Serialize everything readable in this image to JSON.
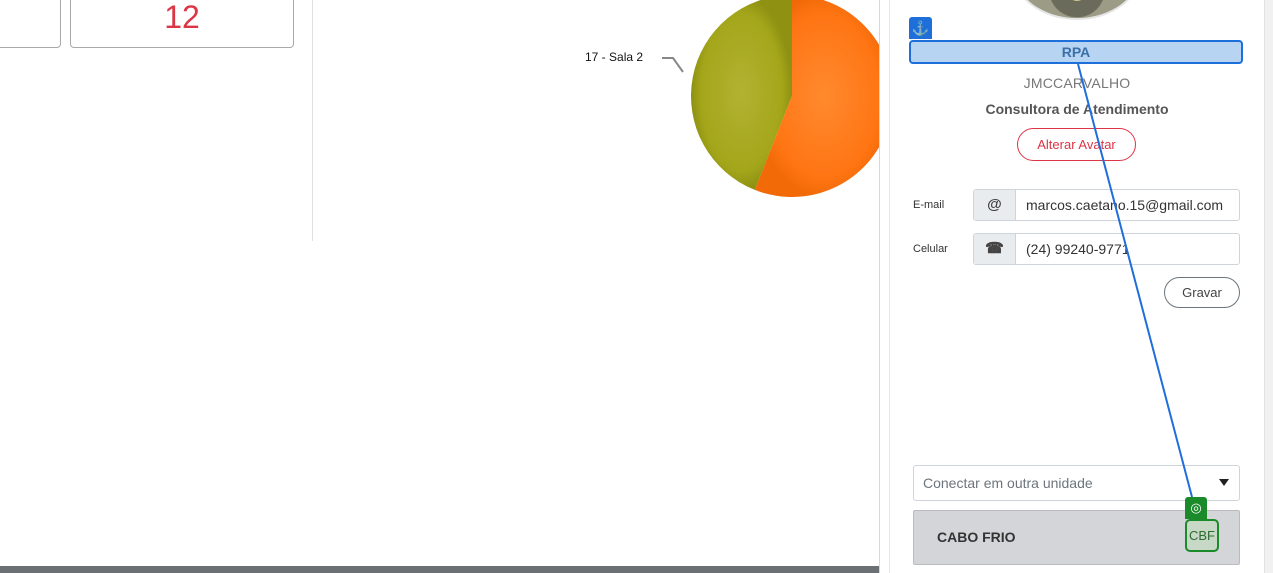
{
  "dashboard": {
    "card_value": "12",
    "chart_data": {
      "type": "pie",
      "slices": [
        {
          "label": "17 - Sala 2",
          "value": 44,
          "color": "#a8a81c"
        },
        {
          "label": "",
          "value": 56,
          "color": "#ff7a1a"
        }
      ]
    },
    "chart_label": "17 - Sala 2"
  },
  "profile": {
    "group_label": "RPA",
    "username": "JMCCARVALHO",
    "role": "Consultora de Atendimento",
    "change_avatar_label": "Alterar Avatar",
    "email_label": "E-mail",
    "email_value": "marcos.caetano.15@gmail.com",
    "phone_label": "Celular",
    "phone_value": "(24) 99240-9771",
    "save_label": "Gravar",
    "unit_select_placeholder": "Conectar em outra unidade",
    "current_unit": "CABO FRIO",
    "current_unit_code": "CBF"
  },
  "icons": {
    "email_icon": "@",
    "phone_icon": "☎",
    "anchor_icon": "⚓",
    "target_icon": "◎"
  },
  "colors": {
    "accent_blue": "#1e6fd9",
    "target_green": "#1a8a2a",
    "danger_red": "#dc3545"
  }
}
